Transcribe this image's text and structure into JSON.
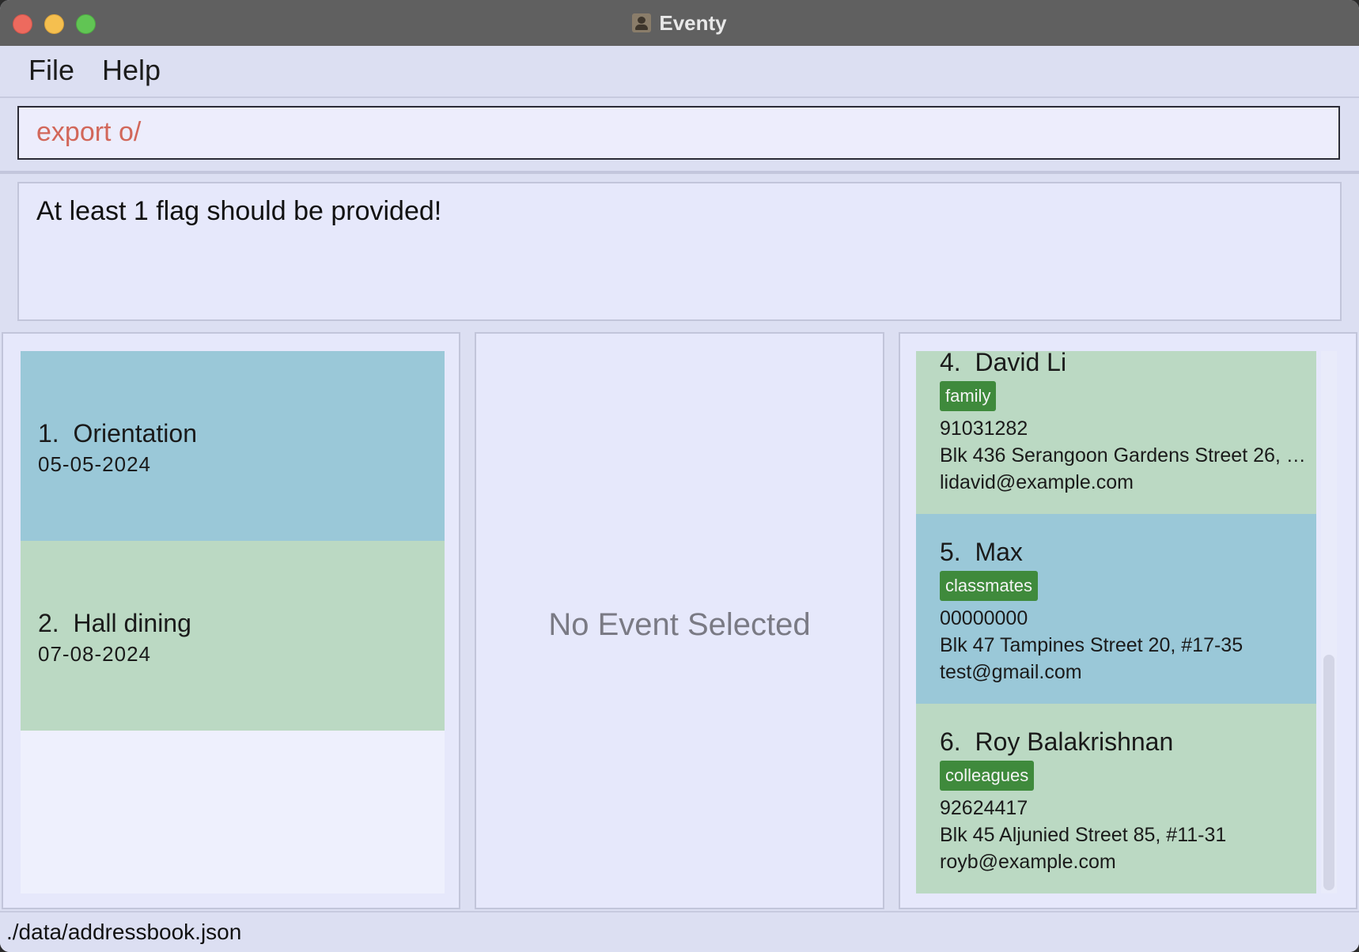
{
  "window": {
    "title": "Eventy"
  },
  "menu": {
    "file": "File",
    "help": "Help"
  },
  "command": {
    "value": "export o/"
  },
  "result": {
    "message": "At least 1 flag should be provided!"
  },
  "events": [
    {
      "index_name": "1.  Orientation",
      "date": "05-05-2024",
      "color": "#9ac8d8"
    },
    {
      "index_name": "2.  Hall dining",
      "date": "07-08-2024",
      "color": "#bbd9c3"
    }
  ],
  "detail": {
    "empty_text": "No Event Selected"
  },
  "persons": [
    {
      "index_name": "4.  David Li",
      "tag": "family",
      "phone": "91031282",
      "address": "Blk 436 Serangoon Gardens Street 26, #...",
      "email": "lidavid@example.com",
      "color": "#bbd9c3"
    },
    {
      "index_name": "5.  Max",
      "tag": "classmates",
      "phone": "00000000",
      "address": "Blk 47 Tampines Street 20, #17-35",
      "email": "test@gmail.com",
      "color": "#9ac8d8"
    },
    {
      "index_name": "6.  Roy Balakrishnan",
      "tag": "colleagues",
      "phone": "92624417",
      "address": "Blk 45 Aljunied Street 85, #11-31",
      "email": "royb@example.com",
      "color": "#bbd9c3"
    }
  ],
  "status": {
    "file_path": "./data/addressbook.json"
  }
}
